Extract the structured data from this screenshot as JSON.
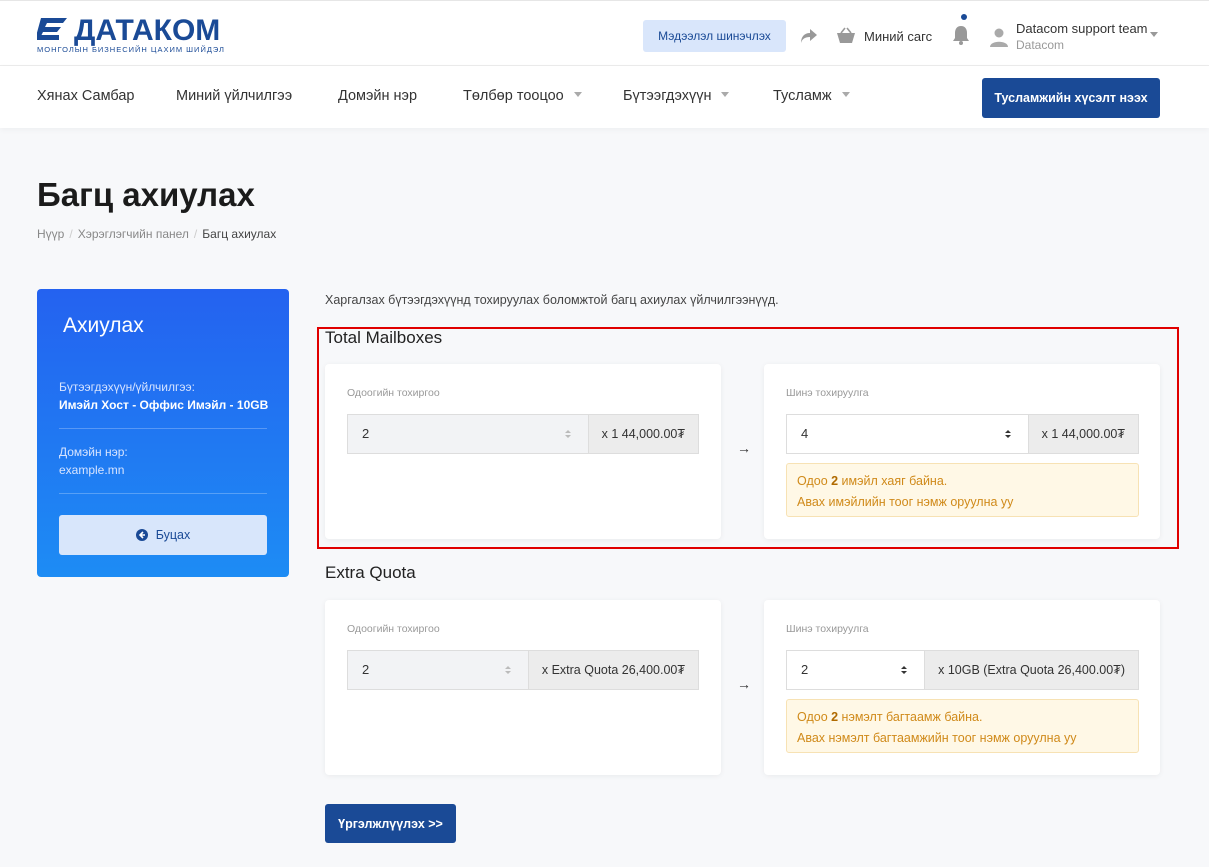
{
  "header": {
    "logo_text": "ДАТАКОМ",
    "logo_subtitle": "МОНГОЛЫН БИЗНЕСИЙН ЦАХИМ ШИЙДЭЛ",
    "update_button": "Мэдээлэл шинэчлэх",
    "cart_label": "Миний сагс",
    "user_name": "Datacom support team",
    "user_org": "Datacom"
  },
  "nav": {
    "items": [
      {
        "label": "Хянах Самбар"
      },
      {
        "label": "Миний үйлчилгээ"
      },
      {
        "label": "Домэйн нэр"
      },
      {
        "label": "Төлбөр тооцоо"
      },
      {
        "label": "Бүтээгдэхүүн"
      },
      {
        "label": "Тусламж"
      }
    ],
    "ticket_button": "Тусламжийн хүсэлт нээх"
  },
  "page": {
    "title": "Багц ахиулах",
    "breadcrumb": [
      "Нүүр",
      "Хэрэглэгчийн панел",
      "Багц ахиулах"
    ]
  },
  "sidebar": {
    "title": "Ахиулах",
    "product_label": "Бүтээгдэхүүн/үйлчилгээ:",
    "product_value": "Имэйл Хост - Оффис Имэйл - 10GB",
    "domain_label": "Домэйн нэр:",
    "domain_value": "example.mn",
    "back_button": "Буцах"
  },
  "main": {
    "intro": "Харгалзах бүтээгдэхүүнд тохируулах боломжтой багц ахиулах үйлчилгээнүүд.",
    "arrow": "→",
    "sections": [
      {
        "title": "Total Mailboxes",
        "current": {
          "label": "Одоогийн тохиргоо",
          "value": "2",
          "addon": "x 1 44,000.00₮"
        },
        "new": {
          "label": "Шинэ тохируулга",
          "value": "4",
          "addon": "x 1 44,000.00₮"
        },
        "note_prefix": "Одоо ",
        "note_count": "2",
        "note_suffix": " имэйл хаяг байна.",
        "note_line2": "Авах имэйлийн тоог нэмж оруулна уу"
      },
      {
        "title": "Extra Quota",
        "current": {
          "label": "Одоогийн тохиргоо",
          "value": "2",
          "addon": "x Extra Quota 26,400.00₮"
        },
        "new": {
          "label": "Шинэ тохируулга",
          "value": "2",
          "addon": "x 10GB (Extra Quota 26,400.00₮)"
        },
        "note_prefix": "Одоо ",
        "note_count": "2",
        "note_suffix": " нэмэлт багтаамж байна.",
        "note_line2": "Авах нэмэлт багтаамжийн тоог нэмж оруулна уу"
      }
    ],
    "continue_button": "Үргэлжлүүлэх >>"
  },
  "colors": {
    "brand": "#1a4a96",
    "sidebar_gradient_start": "#2462f0",
    "sidebar_gradient_end": "#1d8cf4",
    "note_bg": "#fff8e6",
    "note_text": "#d08a1a",
    "highlight": "#e00000"
  }
}
